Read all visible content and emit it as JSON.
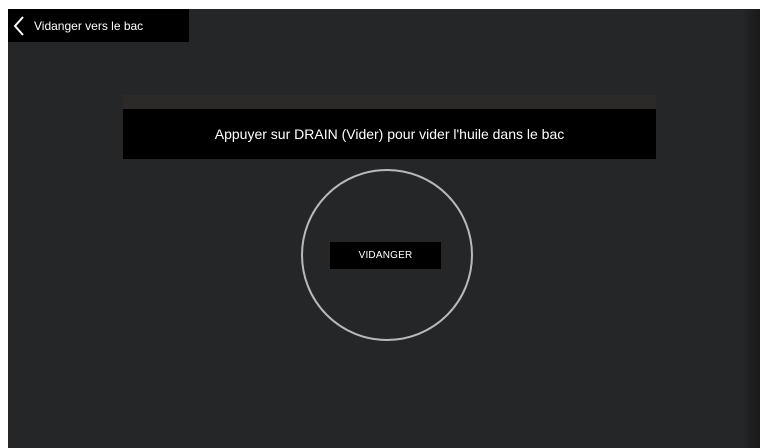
{
  "header": {
    "title": "Vidanger vers le bac",
    "back_icon": "chevron-left-icon"
  },
  "main": {
    "instruction": "Appuyer sur DRAIN (Vider) pour vider l'huile dans le bac",
    "drain_button_label": "VIDANGER"
  },
  "colors": {
    "background": "#252627",
    "panel": "#000000",
    "text": "#ffffff",
    "circle_outline": "#b9b9b9"
  }
}
